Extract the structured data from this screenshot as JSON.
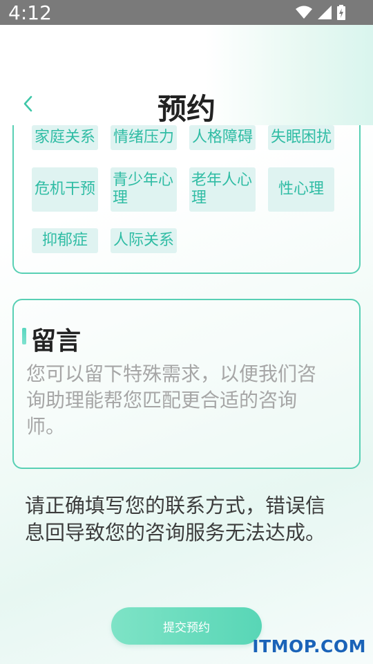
{
  "status_bar": {
    "time": "4:12",
    "icons": [
      "wifi-icon",
      "signal-icon",
      "battery-icon"
    ]
  },
  "header": {
    "title": "预约",
    "back_icon": "chevron-left-icon"
  },
  "tags": [
    {
      "label": "家庭关系"
    },
    {
      "label": "情绪压力"
    },
    {
      "label": "人格障碍"
    },
    {
      "label": "失眠困扰"
    },
    {
      "label": "危机干预"
    },
    {
      "label": "青少年心理"
    },
    {
      "label": "老年人心理"
    },
    {
      "label": "性心理"
    },
    {
      "label": "抑郁症"
    },
    {
      "label": "人际关系"
    }
  ],
  "message": {
    "title": "留言",
    "placeholder": "您可以留下特殊需求，以便我们咨询助理能帮您匹配更合适的咨询师。"
  },
  "notice": "请正确填写您的联系方式，错误信息回导致您的咨询服务无法达成。",
  "submit_label": "提交预约",
  "watermark": "ITMOP.COM",
  "colors": {
    "accent": "#58d0b4",
    "tag_bg": "#dff3f1",
    "tag_text": "#2fbca4",
    "status_bar": "#7a7a7a"
  }
}
